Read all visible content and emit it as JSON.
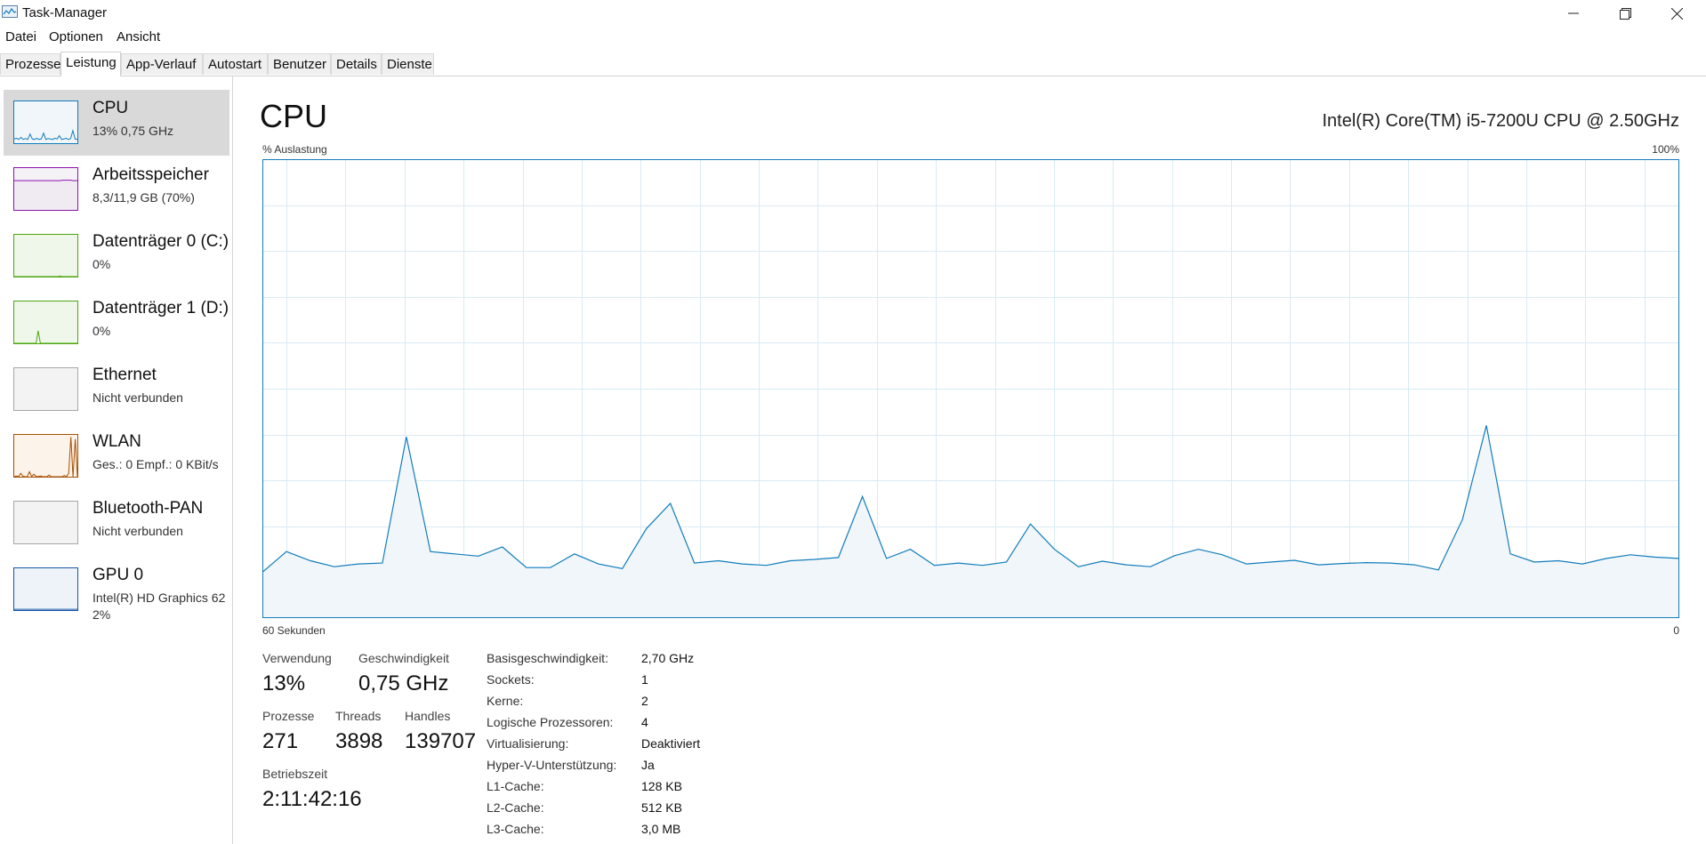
{
  "window": {
    "title": "Task-Manager",
    "icon": "task-manager-icon",
    "controls": [
      "minimize-icon",
      "maximize-icon",
      "close-icon"
    ]
  },
  "menu": [
    "Datei",
    "Optionen",
    "Ansicht"
  ],
  "tabs": [
    {
      "label": "Prozesse",
      "active": false
    },
    {
      "label": "Leistung",
      "active": true
    },
    {
      "label": "App-Verlauf",
      "active": false
    },
    {
      "label": "Autostart",
      "active": false
    },
    {
      "label": "Benutzer",
      "active": false
    },
    {
      "label": "Details",
      "active": false
    },
    {
      "label": "Dienste",
      "active": false
    }
  ],
  "sidebar": {
    "items": [
      {
        "name": "CPU",
        "sub": "13%  0,75 GHz",
        "selected": true,
        "color": "#117dbb",
        "fill": "#f1f6fa"
      },
      {
        "name": "Arbeitsspeicher",
        "sub": "8,3/11,9 GB (70%)",
        "selected": false,
        "color": "#8b12ae",
        "fill": "#f4f2f4"
      },
      {
        "name": "Datenträger 0 (C:)",
        "sub": "0%",
        "selected": false,
        "color": "#4da60c",
        "fill": "#eff7ea"
      },
      {
        "name": "Datenträger 1 (D:)",
        "sub": "0%",
        "selected": false,
        "color": "#4da60c",
        "fill": "#eff7ea"
      },
      {
        "name": "Ethernet",
        "sub": "Nicht verbunden",
        "selected": false,
        "color": "#a7a7a7",
        "fill": "#f3f3f3"
      },
      {
        "name": "WLAN",
        "sub": "Ges.: 0  Empf.: 0 KBit/s",
        "selected": false,
        "color": "#a74f01",
        "fill": "#fcf3eb"
      },
      {
        "name": "Bluetooth-PAN",
        "sub": "Nicht verbunden",
        "selected": false,
        "color": "#a7a7a7",
        "fill": "#f3f3f3"
      },
      {
        "name": "GPU 0",
        "sub": "Intel(R) HD Graphics 62",
        "sub2": "2%",
        "selected": false,
        "color": "#1856a5",
        "fill": "#eef3fa"
      }
    ]
  },
  "main": {
    "title": "CPU",
    "model": "Intel(R) Core(TM) i5-7200U CPU @ 2.50GHz",
    "y_label": "% Auslastung",
    "y_max_label": "100%",
    "x_left_label": "60 Sekunden",
    "x_right_label": "0",
    "graph_colors": {
      "line": "#117dbb",
      "fill": "#f1f6fa",
      "grid": "#d9eaf4",
      "border": "#117dbb"
    }
  },
  "chart_data": {
    "type": "area",
    "x_range": [
      60,
      0
    ],
    "ylim": [
      0,
      100
    ],
    "grid": true,
    "values": [
      10,
      14.5,
      12.5,
      11.2,
      11.8,
      12,
      39.5,
      14.5,
      14,
      13.5,
      15.5,
      11,
      11,
      14,
      11.8,
      10.8,
      19.5,
      25,
      12,
      12.5,
      11.8,
      11.5,
      12.5,
      12.8,
      13.2,
      26.5,
      13,
      15,
      11.5,
      12,
      11.5,
      12.2,
      20.5,
      15,
      11.2,
      12.4,
      11.6,
      11.2,
      13.6,
      15,
      13.8,
      11.8,
      12.2,
      12.6,
      11.6,
      11.9,
      12.1,
      12,
      11.6,
      10.5,
      21.5,
      42,
      14,
      12.2,
      12.5,
      11.8,
      13,
      13.8,
      13.3,
      13
    ]
  },
  "stats": {
    "utilization": {
      "label": "Verwendung",
      "value": "13%"
    },
    "speed": {
      "label": "Geschwindigkeit",
      "value": "0,75 GHz"
    },
    "processes": {
      "label": "Prozesse",
      "value": "271"
    },
    "threads": {
      "label": "Threads",
      "value": "3898"
    },
    "handles": {
      "label": "Handles",
      "value": "139707"
    },
    "uptime": {
      "label": "Betriebszeit",
      "value": "2:11:42:16"
    }
  },
  "info": [
    {
      "key": "Basisgeschwindigkeit:",
      "value": "2,70 GHz"
    },
    {
      "key": "Sockets:",
      "value": "1"
    },
    {
      "key": "Kerne:",
      "value": "2"
    },
    {
      "key": "Logische Prozessoren:",
      "value": "4"
    },
    {
      "key": "Virtualisierung:",
      "value": "Deaktiviert"
    },
    {
      "key": "Hyper-V-Unterstützung:",
      "value": "Ja"
    },
    {
      "key": "L1-Cache:",
      "value": "128 KB"
    },
    {
      "key": "L2-Cache:",
      "value": "512 KB"
    },
    {
      "key": "L3-Cache:",
      "value": "3,0 MB"
    }
  ]
}
